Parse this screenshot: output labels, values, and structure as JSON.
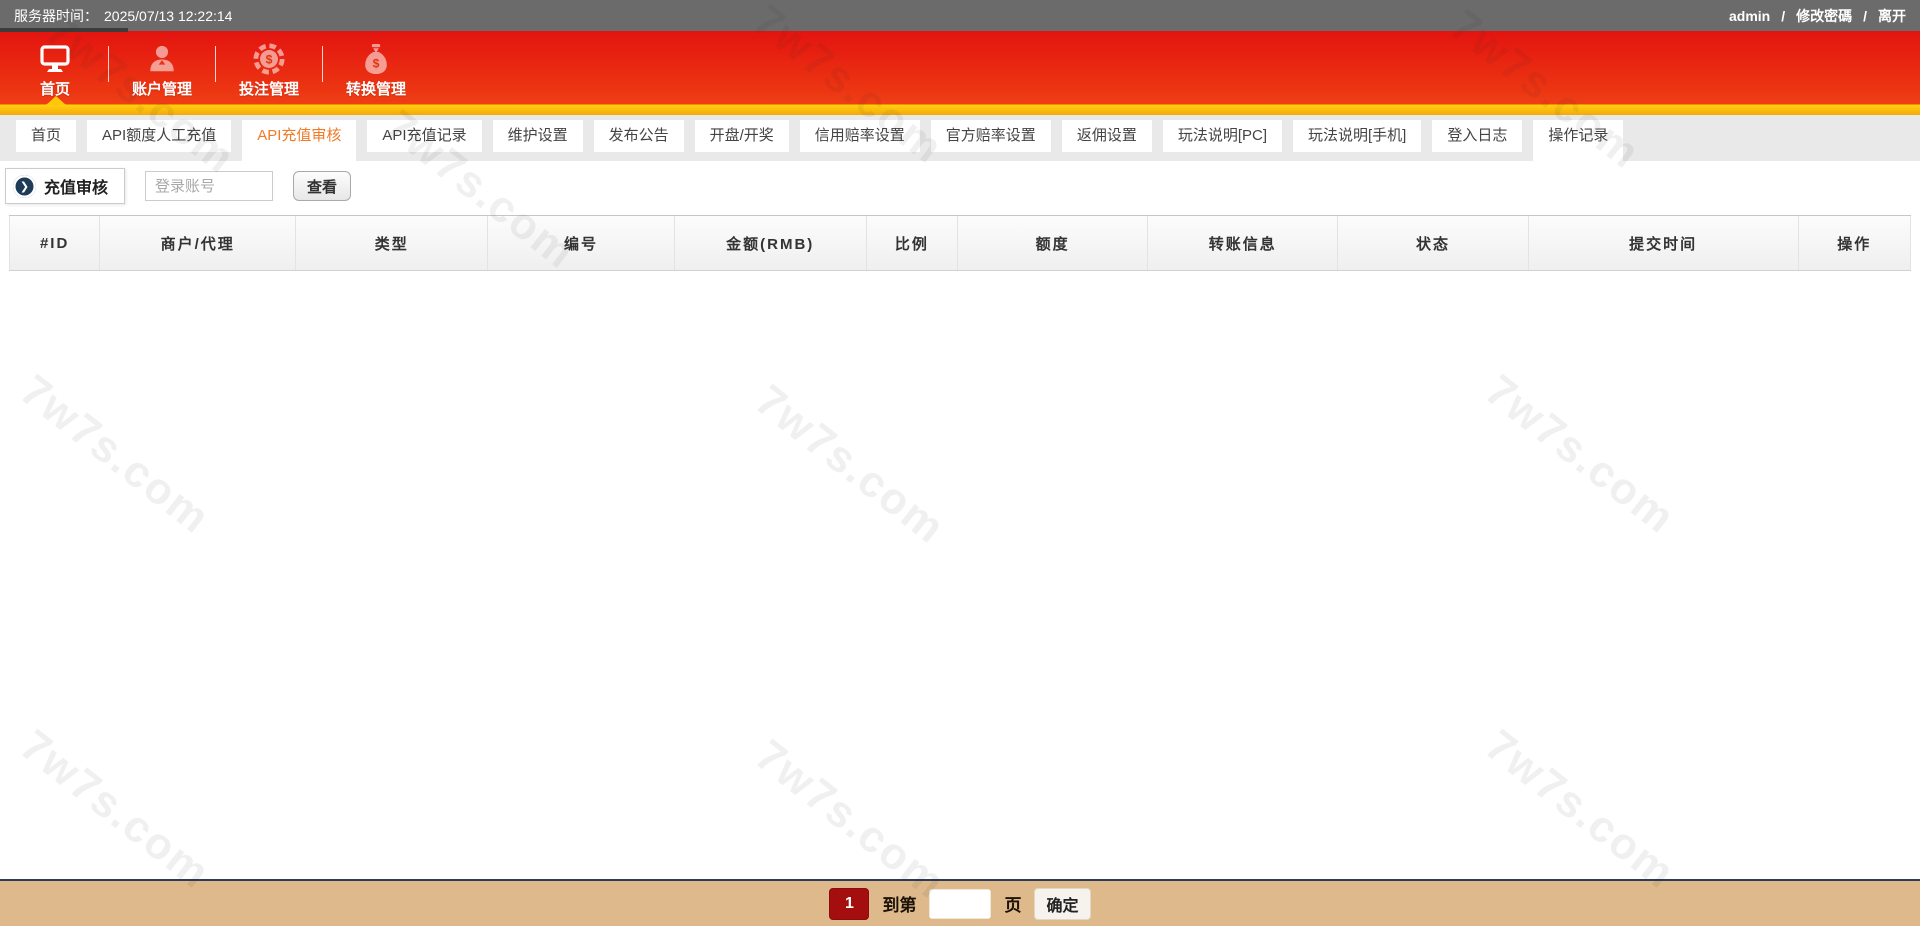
{
  "topbar": {
    "server_time_label": "服务器时间：",
    "server_time": "2025/07/13 12:22:14",
    "username": "admin",
    "sep": "/",
    "change_password": "修改密碼",
    "logout": "离开"
  },
  "navbar": {
    "items": [
      {
        "label": "首页",
        "icon": "monitor-icon",
        "active": true
      },
      {
        "label": "账户管理",
        "icon": "user-icon",
        "active": false
      },
      {
        "label": "投注管理",
        "icon": "poker-chip-icon",
        "active": false
      },
      {
        "label": "转换管理",
        "icon": "money-bag-icon",
        "active": false
      }
    ]
  },
  "tabs": [
    "首页",
    "API额度人工充值",
    "API充值审核",
    "API充值记录",
    "维护设置",
    "发布公告",
    "开盘/开奖",
    "信用赔率设置",
    "官方赔率设置",
    "返佣设置",
    "玩法说明[PC]",
    "玩法说明[手机]",
    "登入日志",
    "操作记录"
  ],
  "active_tab": "API充值审核",
  "toolbar": {
    "section_title": "充值审核",
    "section_icon": "audit-play-icon",
    "section_icon_glyph": "❯",
    "search_placeholder": "登录账号",
    "view_button": "查看"
  },
  "table": {
    "columns": [
      "#ID",
      "商户/代理",
      "类型",
      "编号",
      "金额(RMB)",
      "比例",
      "额度",
      "转账信息",
      "状态",
      "提交时间",
      "操作"
    ],
    "rows": []
  },
  "pagination": {
    "current_page": "1",
    "goto_prefix": "到第",
    "goto_value": "",
    "goto_suffix": "页",
    "confirm_button": "确定"
  },
  "watermark": {
    "text": "7w7s.com"
  },
  "colors": {
    "topbar_bg": "#6b6b6b",
    "nav_red_top": "#e31410",
    "nav_red_bottom": "#f0471a",
    "nav_strip_yellow": "#ffc60a",
    "tabbar_bg": "#e9e9e9",
    "active_tab_text": "#ef7b2a",
    "pagination_bg": "#ddb98b",
    "pagination_border": "#2e3b55",
    "page_btn_red": "#a50e0e",
    "audit_icon_navy": "#1e3c58"
  }
}
